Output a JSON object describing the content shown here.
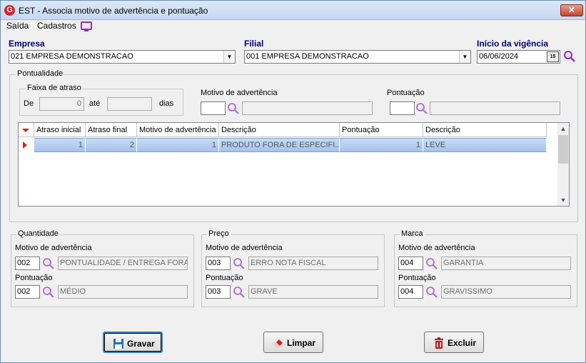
{
  "window": {
    "app_icon_letter": "G",
    "title": "EST - Associa motivo de advertência e pontuação",
    "close_label": "✕"
  },
  "menu": {
    "items": [
      "Saída",
      "Cadastros"
    ]
  },
  "header": {
    "empresa_label": "Empresa",
    "empresa_value": "021 EMPRESA DEMONSTRACAO",
    "filial_label": "Filial",
    "filial_value": "001 EMPRESA DEMONSTRACAO",
    "vigencia_label": "Início da vigência",
    "vigencia_value": "06/06/2024",
    "calendar_label": "15"
  },
  "pontualidade": {
    "group_label": "Pontualidade",
    "faixa_label": "Faixa de atraso",
    "de_label": "De",
    "de_value": "0",
    "ate_label": "até",
    "ate_value": "",
    "dias_label": "dias",
    "motivo_label": "Motivo de advertência",
    "motivo_code": "",
    "motivo_desc": "",
    "pontuacao_label": "Pontuação",
    "pontuacao_code": "",
    "pontuacao_desc": ""
  },
  "grid": {
    "columns": [
      "Atraso inicial",
      "Atraso final",
      "Motivo de advertência",
      "Descrição",
      "Pontuação",
      "Descrição"
    ],
    "rows": [
      [
        "1",
        "2",
        "1",
        "PRODUTO FORA DE ESPECIFI...",
        "1",
        "LEVE"
      ]
    ]
  },
  "quantidade": {
    "group_label": "Quantidade",
    "motivo_label": "Motivo de advertência",
    "motivo_code": "002",
    "motivo_desc": "PONTUALIDADE / ENTREGA FORA",
    "pontuacao_label": "Pontuação",
    "pontuacao_code": "002",
    "pontuacao_desc": "MÉDIO"
  },
  "preco": {
    "group_label": "Preço",
    "motivo_label": "Motivo de advertência",
    "motivo_code": "003",
    "motivo_desc": "ERRO NOTA FISCAL",
    "pontuacao_label": "Pontuação",
    "pontuacao_code": "003",
    "pontuacao_desc": "GRAVE"
  },
  "marca": {
    "group_label": "Marca",
    "motivo_label": "Motivo de advertência",
    "motivo_code": "004",
    "motivo_desc": "GARANTIA",
    "pontuacao_label": "Pontuação",
    "pontuacao_code": "004",
    "pontuacao_desc": "GRAVISSIMO"
  },
  "buttons": {
    "gravar": "Gravar",
    "limpar": "Limpar",
    "excluir": "Excluir"
  },
  "colors": {
    "accent_label": "#00007a",
    "lookup_icon": "#9b28c6",
    "selection": "#a4c2ea"
  }
}
